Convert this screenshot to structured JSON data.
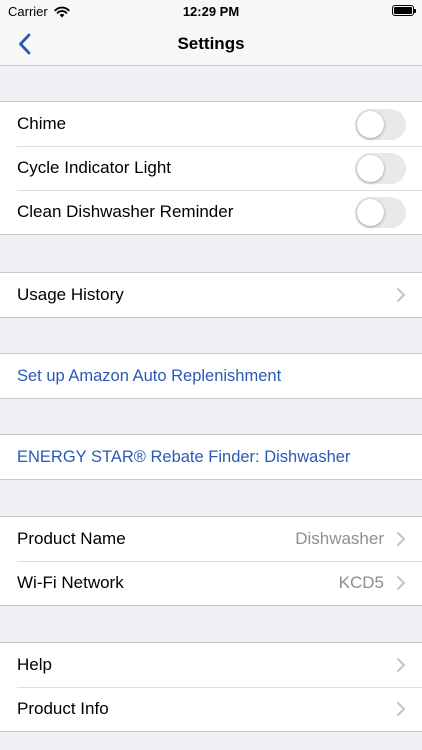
{
  "status_bar": {
    "carrier": "Carrier",
    "time": "12:29 PM"
  },
  "nav": {
    "title": "Settings"
  },
  "toggles": [
    {
      "label": "Chime",
      "on": false
    },
    {
      "label": "Cycle Indicator Light",
      "on": false
    },
    {
      "label": "Clean Dishwasher Reminder",
      "on": false
    }
  ],
  "usage": {
    "label": "Usage History"
  },
  "amazon": {
    "label": "Set up Amazon Auto Replenishment"
  },
  "energy": {
    "label": "ENERGY STAR® Rebate Finder: Dishwasher"
  },
  "device": [
    {
      "label": "Product Name",
      "value": "Dishwasher"
    },
    {
      "label": "Wi-Fi Network",
      "value": "KCD5"
    }
  ],
  "support": [
    {
      "label": "Help"
    },
    {
      "label": "Product Info"
    }
  ],
  "colors": {
    "link": "#2a5ab7",
    "background": "#efeff4",
    "secondary_text": "#8e8e93"
  }
}
